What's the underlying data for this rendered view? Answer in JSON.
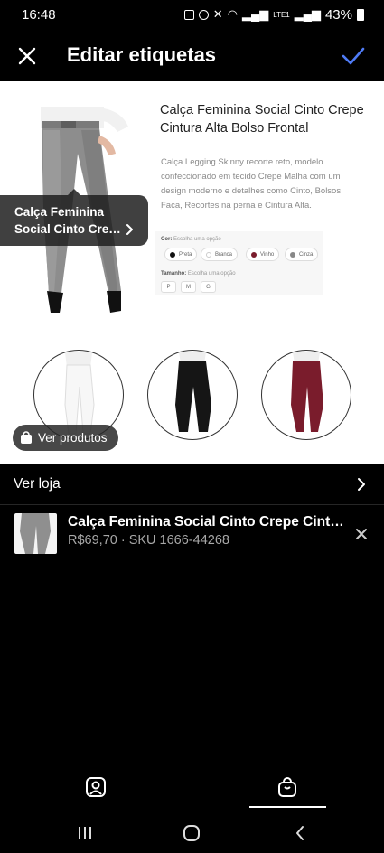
{
  "status_bar": {
    "time": "16:48",
    "battery": "43%",
    "network": "LTE1"
  },
  "header": {
    "title": "Editar etiquetas"
  },
  "photo": {
    "product_title": "Calça Feminina Social Cinto Crepe Cintura Alta Bolso Frontal",
    "product_desc": "Calça Legging Skinny recorte reto, modelo confeccionado em tecido Crepe Malha com um design moderno e detalhes como Cinto, Bolsos Faca, Recortes na perna e Cintura Alta.",
    "color_label": "Cor:",
    "color_hint": "Escolha uma opção",
    "colors": [
      {
        "name": "Preta",
        "hex": "#111111"
      },
      {
        "name": "Branca",
        "hex": "#ffffff"
      },
      {
        "name": "Vinho",
        "hex": "#7a1c2c"
      },
      {
        "name": "Cinza",
        "hex": "#888888"
      }
    ],
    "size_label": "Tamanho:",
    "size_hint": "Escolha uma opção",
    "sizes": [
      "P",
      "M",
      "G"
    ]
  },
  "tag": {
    "line1": "Calça Feminina",
    "line2": "Social Cinto Crepe Cintura Alta Bolso Frontal"
  },
  "ver_produtos": "Ver produtos",
  "ver_loja": "Ver loja",
  "product": {
    "name": "Calça Feminina Social Cinto Crepe Cintura Alta Bolso Frontal",
    "meta": "R$69,70 · SKU 1666-44268"
  },
  "colors": {
    "accent": "#4f7bf5",
    "background": "#000000"
  }
}
